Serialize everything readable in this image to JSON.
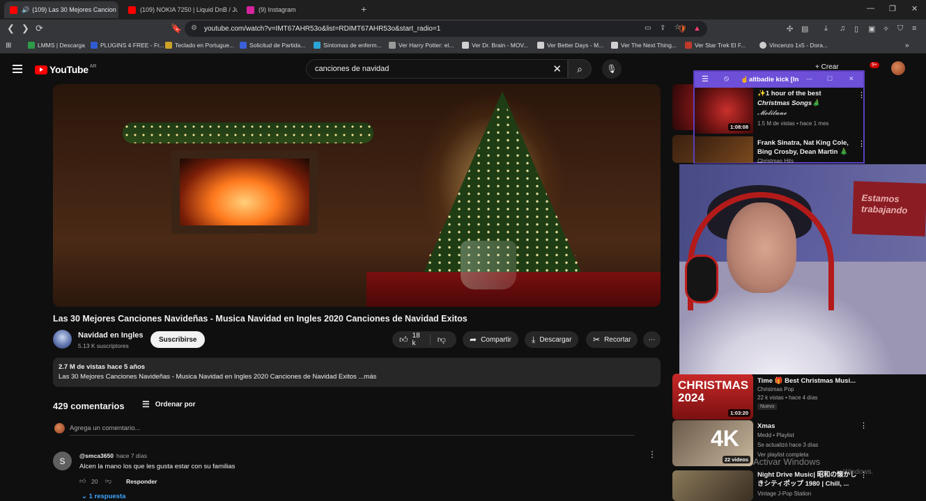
{
  "browser": {
    "tabs": [
      {
        "label": "(109) Las 30 Mejores Cancion",
        "active": true,
        "favicon_color": "#ff0000"
      },
      {
        "label": "(109) NOKIA 7250 | Liquid DnB / Jung",
        "active": false,
        "favicon_color": "#ff0000"
      },
      {
        "label": "(9) Instagram",
        "active": false,
        "favicon_color": "#d6249f"
      }
    ],
    "new_tab": "+",
    "url": "youtube.com/watch?v=IMT67AHR53o&list=RDIMT67AHR53o&start_radio=1",
    "bookmarks": [
      {
        "label": "LMMS | Descarga",
        "color": "#2e9b48"
      },
      {
        "label": "PLUGINS 4 FREE - Fr...",
        "color": "#2f5bd3"
      },
      {
        "label": "Teclado en Portugue...",
        "color": "#c9a227"
      },
      {
        "label": "Solicitud de Partida...",
        "color": "#3a5fd8"
      },
      {
        "label": "Síntomas de enferm...",
        "color": "#2ba6d8"
      },
      {
        "label": "Ver Harry Potter: el...",
        "color": "#999999"
      },
      {
        "label": "Ver Dr. Brain - MOV...",
        "color": "#d0d0d0"
      },
      {
        "label": "Ver Better Days - M...",
        "color": "#d0d0d0"
      },
      {
        "label": "Ver The Next Thing...",
        "color": "#d0d0d0"
      },
      {
        "label": "Ver Star Trek El F...",
        "color": "#c0392b"
      },
      {
        "label": "Vincenzo 1x5 - Dora...",
        "color": "#cccccc"
      }
    ]
  },
  "youtube": {
    "logo_text": "YouTube",
    "country_code": "AR",
    "search_query": "canciones de navidad",
    "create_label": "Crear",
    "notifications_badge": "9+",
    "video": {
      "title": "Las 30 Mejores Canciones Navideñas - Musica Navidad en Ingles 2020 Canciones de Navidad Exitos",
      "channel": "Navidad en Ingles",
      "subscribers": "5.13 K suscriptores",
      "subscribe_label": "Suscribirse",
      "likes": "18 k",
      "share_label": "Compartir",
      "download_label": "Descargar",
      "clip_label": "Recortar",
      "views_line": "2.7 M de vistas  hace 5 años",
      "description": "Las 30 Mejores Canciones Navideñas - Musica Navidad en Ingles 2020   Canciones de Navidad Exitos ...más"
    },
    "comments": {
      "count_label": "429 comentarios",
      "sort_label": "Ordenar por",
      "add_placeholder": "Agrega un comentario...",
      "items": [
        {
          "avatar_letter": "S",
          "author": "@smca3650",
          "time": "hace 7 días",
          "text": "Alcen la mano los que les gusta estar con su familias",
          "likes": "20",
          "reply_label": "Responder",
          "replies_label": "1 respuesta"
        }
      ]
    },
    "sidebar": [
      {
        "title_lines": [
          "✨1 hour of the best",
          "Christmas Songs🎄",
          "𝓜𝓮𝓵𝓲𝓵𝓾𝓷𝓮"
        ],
        "meta": "1.5 M de vistas • hace 1 mes",
        "duration": "1:08:08"
      },
      {
        "title_lines": [
          "Frank Sinatra, Nat King Cole,",
          "Bing Crosby, Dean Martin 🎄 ..."
        ],
        "meta": "Christmas Hits",
        "duration": ""
      },
      {
        "title_lines": [
          "Time 🎁 Best Christmas Musi..."
        ],
        "meta": "Christmas Pop",
        "meta2": "22 k vistas • hace 4 días",
        "badge": "Nuevo",
        "duration": "1:03:20"
      },
      {
        "title_lines": [
          "Xmas"
        ],
        "meta": "Medd • Playlist",
        "meta2": "Se actualizó hace 3 días",
        "meta3": "Ver playlist completa",
        "duration": "22 videos"
      },
      {
        "title_lines": [
          "Night Drive Music| 昭和の懐かし",
          "きシティポップ 1980 | Chill, ..."
        ],
        "meta": "Vintage J-Pop Station",
        "duration": ""
      }
    ]
  },
  "overlay_window": {
    "title": "altbadie kick [In"
  },
  "webcam": {
    "sign_text": "Estamos trabajando"
  },
  "os": {
    "activation_watermark": "Activar Windows",
    "activation_sub": "Windows."
  }
}
